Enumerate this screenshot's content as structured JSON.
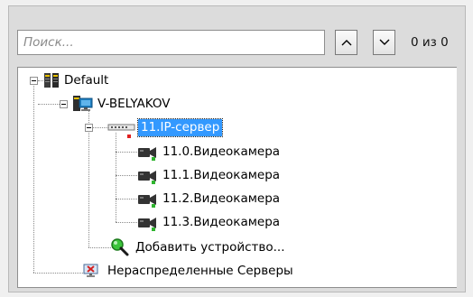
{
  "search": {
    "placeholder": "Поиск..."
  },
  "nav": {
    "counter": "0 из 0"
  },
  "tree": {
    "root": "Default",
    "server": "V-BELYAKOV",
    "ip_server": "11.IP-сервер",
    "cameras": [
      "11.0.Видеокамера",
      "11.1.Видеокамера",
      "11.2.Видеокамера",
      "11.3.Видеокамера"
    ],
    "add_device": "Добавить устройство...",
    "unassigned": "Нераспределенные Серверы"
  },
  "colors": {
    "selection": "#3399ff",
    "camera_status": "#2fb52f",
    "alert": "#e02020"
  }
}
